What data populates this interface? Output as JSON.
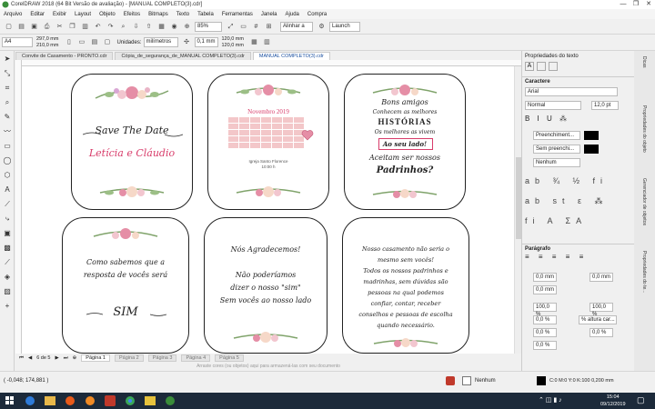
{
  "window": {
    "title": "CorelDRAW 2018 (64 Bit Versão de avaliação) - [MANUAL COMPLETO(3).cdr]",
    "btn_min": "—",
    "btn_max": "❐",
    "btn_close": "✕"
  },
  "menu": [
    "Arquivo",
    "Editar",
    "Exibir",
    "Layout",
    "Objeto",
    "Efeitos",
    "Bitmaps",
    "Texto",
    "Tabela",
    "Ferramentas",
    "Janela",
    "Ajuda",
    "Compra"
  ],
  "toolbar1": {
    "zoom": "85%",
    "snap_label": "Alinhar a",
    "launch_label": "Launch"
  },
  "toolbar2": {
    "page_size": "A4",
    "width": "297,0 mm",
    "height": "210,0 mm",
    "units_label": "Unidades:",
    "units_value": "milímetros",
    "nudge": "0,1 mm",
    "dup_x": "120,0 mm",
    "dup_y": "120,0 mm"
  },
  "doc_tabs": [
    {
      "label": "Convite de Casamento - PRONTO.cdr",
      "active": false
    },
    {
      "label": "Cópia_de_segurança_de_MANUAL COMPLETO(3).cdr",
      "active": false
    },
    {
      "label": "MANUAL COMPLETO(3).cdr",
      "active": true
    }
  ],
  "cards": {
    "c1": {
      "title": "Save The Date",
      "names": "Letícia e Cláudio"
    },
    "c2": {
      "month": "Novembro 2019",
      "venue": "Igreja Santo Florence",
      "time": "10:00 h"
    },
    "c3": {
      "l1": "Bons amigos",
      "l2": "Conhecem as melhores",
      "l3": "HISTÓRIAS",
      "l4": "Os melhores as vivem",
      "l5": "Ao seu lado!",
      "l6": "Aceitam ser nossos",
      "l7": "Padrinhos?"
    },
    "c4": {
      "l1": "Como sabemos que a",
      "l2": "resposta de vocês será",
      "l3": "SIM"
    },
    "c5": {
      "l1": "Nós Agradecemos!",
      "l2": "Não poderíamos",
      "l3": "dizer o nosso \"sim\"",
      "l4": "Sem vocês ao nosso lado"
    },
    "c6": {
      "l1": "Nosso casamento não seria o",
      "l2": "mesmo sem vocês!",
      "l3": "Todos os nossos padrinhos e",
      "l4": "madrinhas, sem dúvidas são",
      "l5": "pessoas na qual podemos",
      "l6": "confiar, contar, receber",
      "l7": "conselhos e pessoas de escolha",
      "l8": "quando necessário."
    }
  },
  "pages": {
    "counter": "6 de 5",
    "tabs": [
      "Página 1",
      "Página 2",
      "Página 3",
      "Página 4",
      "Página 5"
    ]
  },
  "hint": "Arraste cores (ou objetos) aqui para armazená-las com seu documento",
  "status": {
    "coords": "( -0,048; 174,881 )",
    "fill_label": "Nenhum",
    "color_info": "C:0 M:0 Y:0 K:100  0,200 mm"
  },
  "panel": {
    "title": "Propriedades do texto",
    "section_char": "Caractere",
    "font": "Arial",
    "style": "Normal",
    "size": "12,0 pt",
    "fill1": "Preenchiment...",
    "fill2": "Sem preenchi...",
    "fill3": "Nenhum",
    "section_para": "Parágrafo",
    "indent1": "0,0 mm",
    "indent2": "0,0 mm",
    "indent3": "0,0 mm",
    "spacing1": "100,0 %",
    "spacing2": "100,0 %",
    "spacing3": "0,0 %",
    "spacing4": "% altura car...",
    "spacing5": "0,0 %",
    "spacing6": "0,0 %",
    "spacing7": "0,0 %"
  },
  "side_tabs": [
    "Dicas",
    "Propriedades do objeto",
    "Gerenciador de objetos",
    "Propriedades do te..."
  ],
  "taskbar": {
    "time": "15:04",
    "date": "09/12/2019"
  },
  "colors": {
    "pink": "#d83c6a",
    "flower": "#e58ea6",
    "leaf": "#7fa36a"
  }
}
